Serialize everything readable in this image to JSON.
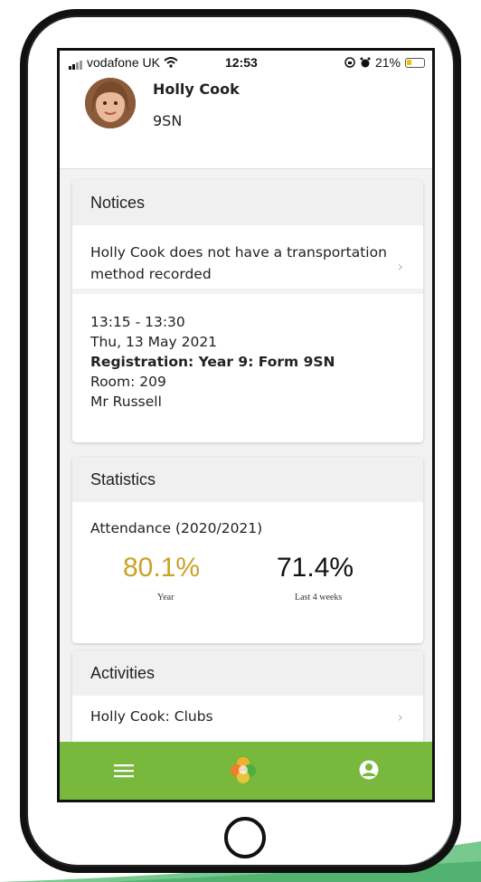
{
  "status_bar": {
    "carrier": "vodafone UK",
    "time": "12:53",
    "battery": "21%",
    "battery_level": 0.21,
    "icons": [
      "signal-icon",
      "wifi-icon",
      "orientation-lock-icon",
      "alarm-icon",
      "battery-icon"
    ]
  },
  "student": {
    "name": "Holly Cook",
    "form": "9SN"
  },
  "notices": {
    "title": "Notices",
    "item": "Holly Cook does not have a transportation method recorded",
    "registration": {
      "time": "13:15 - 13:30",
      "date": "Thu, 13 May 2021",
      "title": "Registration: Year 9: Form 9SN",
      "room": "Room: 209",
      "teacher": "Mr Russell"
    }
  },
  "statistics": {
    "title": "Statistics",
    "subtitle": "Attendance (2020/2021)",
    "year_value": "80.1%",
    "year_label": "Year",
    "recent_value": "71.4%",
    "recent_label": "Last 4 weeks",
    "year_color": "#c9a227",
    "recent_color": "#111111"
  },
  "activities": {
    "title": "Activities",
    "item": "Holly Cook: Clubs"
  },
  "bottom_nav": {
    "color": "#77b83d",
    "icons": [
      "menu-icon",
      "clover-logo-icon",
      "profile-icon"
    ]
  }
}
